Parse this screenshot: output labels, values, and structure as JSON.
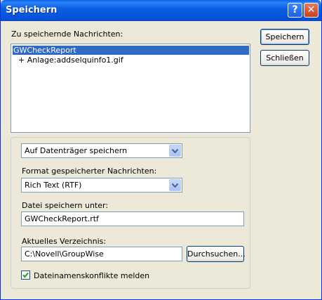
{
  "window": {
    "title": "Speichern"
  },
  "titlebar": {
    "help_glyph": "?",
    "close_glyph": "✕"
  },
  "messages": {
    "label": "Zu speichernde Nachrichten:",
    "items": [
      "GWCheckReport",
      "+ Anlage:addselquinfo1.gif"
    ]
  },
  "buttons": {
    "save": "Speichern",
    "close": "Schließen",
    "browse": "Durchsuchen..."
  },
  "destination": {
    "value": "Auf Datenträger speichern"
  },
  "format": {
    "label": "Format gespeicherter Nachrichten:",
    "value": "Rich Text (RTF)"
  },
  "filename": {
    "label": "Datei speichern unter:",
    "value": "GWCheckReport.rtf"
  },
  "directory": {
    "label": "Aktuelles Verzeichnis:",
    "value": "C:\\Novell\\GroupWise"
  },
  "conflicts": {
    "label": "Dateinamenskonflikte melden",
    "checked": true
  },
  "icons": [
    "help-icon",
    "close-icon",
    "dropdown-arrow-icon",
    "checkmark-icon"
  ],
  "colors": {
    "titlebar": "#0553dc",
    "selection": "#316ac5",
    "face": "#ece9d8"
  }
}
